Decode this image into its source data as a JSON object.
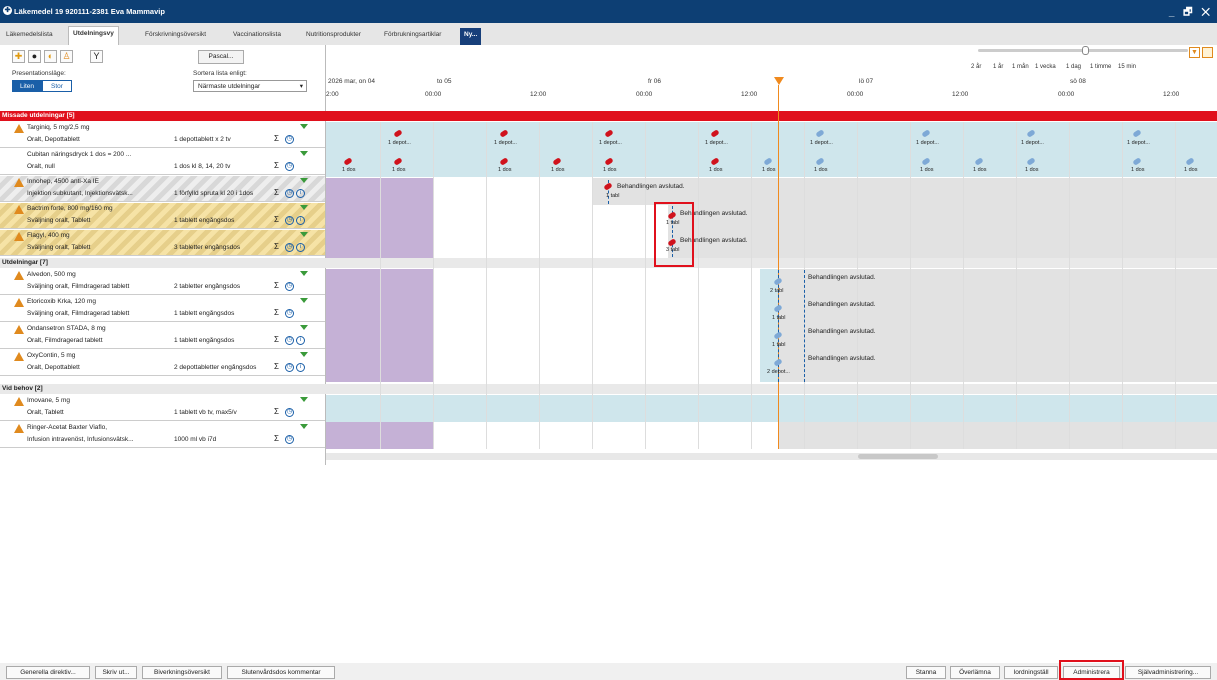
{
  "window": {
    "title": "Läkemedel 19 920111-2381 Eva Mammavip",
    "controls": "_ 🗗 ✕"
  },
  "tabs": [
    "Läkemedelslista",
    "Utdelningsvy",
    "Förskrivningsöversikt",
    "Vaccinationslista",
    "Nutritionsprodukter",
    "Förbrukningsartiklar",
    "Ny..."
  ],
  "active_tab": "Utdelningsvy",
  "toolbar": {
    "pascal": "Pascal...",
    "presentation_label": "Presentationsläge:",
    "sort_label": "Sortera lista enligt:",
    "liten": "Liten",
    "stor": "Stor",
    "sort_value": "Närmaste utdelningar"
  },
  "zoom": {
    "labels": [
      "2 år",
      "1 år",
      "1 mån",
      "1 vecka",
      "1 dag",
      "1 timme",
      "15 min"
    ],
    "level": "1 dag"
  },
  "timeline": {
    "days": [
      "2026 mar, on 04",
      "to 05",
      "fr 06",
      "lö 07",
      "sö 08"
    ],
    "hours": [
      "2:00",
      "00:00",
      "12:00",
      "00:00",
      "12:00",
      "00:00",
      "12:00",
      "00:00",
      "12:00"
    ]
  },
  "sections": {
    "missade": "Missade utdelningar [5]",
    "utdelningar": "Utdelningar [7]",
    "vidbehov": "Vid behov [2]"
  },
  "rows": [
    {
      "name": "Targiniq, 5 mg/2,5 mg",
      "route": "Oralt, Depottablett",
      "dose": "1 depottablett x 2 tv"
    },
    {
      "name": "Cubitan näringsdryck 1 dos = 200 ...",
      "route": "Oralt, null",
      "dose": "1 dos kl 8, 14, 20 tv"
    },
    {
      "name": "Innohep, 4500 anti-Xa IE",
      "route": "Injektion subkutant, Injektionsvätsk...",
      "dose": "1 förfylld spruta kl 20 i 1dos"
    },
    {
      "name": "Bactrim forte, 800 mg/160 mg",
      "route": "Sväljning oralt, Tablett",
      "dose": "1 tablett engångsdos"
    },
    {
      "name": "Flagyl, 400 mg",
      "route": "Sväljning oralt, Tablett",
      "dose": "3 tabletter engångsdos"
    },
    {
      "name": "Alvedon, 500 mg",
      "route": "Sväljning oralt, Filmdragerad tablett",
      "dose": "2 tabletter engångsdos"
    },
    {
      "name": "Etoricoxib Krka, 120 mg",
      "route": "Sväljning oralt, Filmdragerad tablett",
      "dose": "1 tablett engångsdos"
    },
    {
      "name": "Ondansetron STADA, 8 mg",
      "route": "Oralt, Filmdragerad tablett",
      "dose": "1 tablett engångsdos"
    },
    {
      "name": "OxyContin, 5 mg",
      "route": "Oralt, Depottablett",
      "dose": "2 depottabletter engångsdos"
    },
    {
      "name": "Imovane, 5 mg",
      "route": "Oralt, Tablett",
      "dose": "1 tablett vb tv, max5/v"
    },
    {
      "name": "Ringer-Acetat Baxter Viaflo,",
      "route": "Infusion intravenöst, Infusionsvätsk...",
      "dose": "1000 ml vb i7d"
    }
  ],
  "marks": {
    "depot": "1 depot...",
    "dos": "1 dos",
    "tabl1": "1 tabl",
    "tabl3": "3 tabl",
    "tabl2": "2 tabl",
    "depot2": "2 depot...",
    "avslutad": "Behandlingen avslutad."
  },
  "bottom_left": [
    "Generella direktiv...",
    "Skriv ut...",
    "Biverkningsöversikt",
    "Slutenvårdsdos kommentar"
  ],
  "bottom_right": [
    "Stanna",
    "Överlämna",
    "Iordningställ",
    "Administrera",
    "Självadministrering..."
  ],
  "colors": {
    "titlebar": "#0d3f74",
    "missed_bar": "#e0101c",
    "teal": "#cfe6ec",
    "purple": "#c5b1d6",
    "highlight": "#e0101c"
  }
}
